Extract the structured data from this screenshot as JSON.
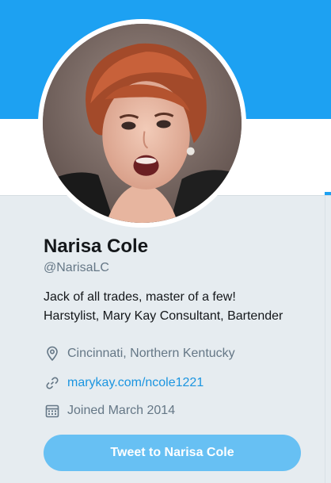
{
  "profile": {
    "name": "Narisa Cole",
    "handle": "@NarisaLC",
    "bio_line1": "Jack of all trades, master of a few!",
    "bio_line2": "Harstylist, Mary Kay Consultant, Bartender",
    "location": "Cincinnati, Northern Kentucky",
    "website": "marykay.com/ncole1221",
    "joined": "Joined March 2014"
  },
  "actions": {
    "tweet_to_label": "Tweet to Narisa Cole"
  },
  "colors": {
    "banner": "#1da1f2",
    "link": "#1b95e0",
    "button": "#67c0f3",
    "text_secondary": "#657786"
  },
  "icons": {
    "location": "map-pin-icon",
    "link": "link-icon",
    "joined": "calendar-icon"
  }
}
